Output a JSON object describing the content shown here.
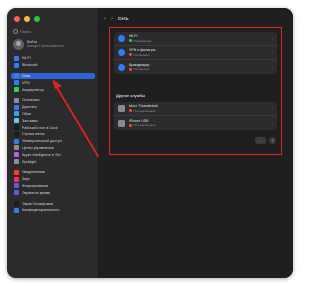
{
  "sidebar": {
    "search_placeholder": "Поиск",
    "account": {
      "name": "Войти",
      "sub": "Аккаунт пользователя"
    },
    "items": [
      {
        "label": "Wi-Fi",
        "color": "#2f7cf6"
      },
      {
        "label": "Bluetooth",
        "color": "#2f7cf6"
      },
      {
        "label": "Сеть",
        "color": "#2f7cf6",
        "active": true
      },
      {
        "label": "VPN",
        "color": "#2f7cf6"
      },
      {
        "label": "Аккумулятор",
        "color": "#30d158"
      },
      {
        "label": "Основные",
        "color": "#8e8e93"
      },
      {
        "label": "Дисплеи",
        "color": "#2f7cf6"
      },
      {
        "label": "Обои",
        "color": "#34aadc"
      },
      {
        "label": "Заставка",
        "color": "#5ac8fa"
      },
      {
        "label": "Рабочий стол и Dock",
        "color": "#1c1c1e"
      },
      {
        "label": "Строка меню",
        "color": "#1c1c1e"
      },
      {
        "label": "Универсальный доступ",
        "color": "#2f7cf6"
      },
      {
        "label": "Центр управления",
        "color": "#8e8e93"
      },
      {
        "label": "Apple Intelligence и Siri",
        "color": "#bf5af2"
      },
      {
        "label": "Spotlight",
        "color": "#8e8e93"
      },
      {
        "label": "Уведомления",
        "color": "#ff3b30"
      },
      {
        "label": "Звук",
        "color": "#ff2d55"
      },
      {
        "label": "Фокусирование",
        "color": "#5e5ce6"
      },
      {
        "label": "Экранное время",
        "color": "#5e5ce6"
      },
      {
        "label": "Экран блокировки",
        "color": "#1c1c1e"
      },
      {
        "label": "Конфиденциальность",
        "color": "#2f7cf6"
      }
    ]
  },
  "toolbar": {
    "back": "‹",
    "forward": "›",
    "title": "Сеть"
  },
  "services_top": [
    {
      "name": "Wi-Fi",
      "status": "Подключено",
      "status_color": "green",
      "icon": "wifi-icon"
    },
    {
      "name": "VPN и фильтры",
      "status": "Отключено",
      "status_color": "red",
      "icon": "vpn-icon"
    },
    {
      "name": "Брандмауэр",
      "status": "Отключено",
      "status_color": "red",
      "icon": "firewall-icon"
    }
  ],
  "other_label": "Другие службы",
  "services_other": [
    {
      "name": "Мост Thunderbolt",
      "status": "Не подключено",
      "status_color": "red",
      "icon": "thunderbolt-icon"
    },
    {
      "name": "iPhone USB",
      "status": "Не подключено",
      "status_color": "red",
      "icon": "phone-icon"
    }
  ],
  "footer": {
    "more_label": "…",
    "help_label": "?"
  },
  "annotation": {
    "highlight_color": "#e2231a"
  }
}
